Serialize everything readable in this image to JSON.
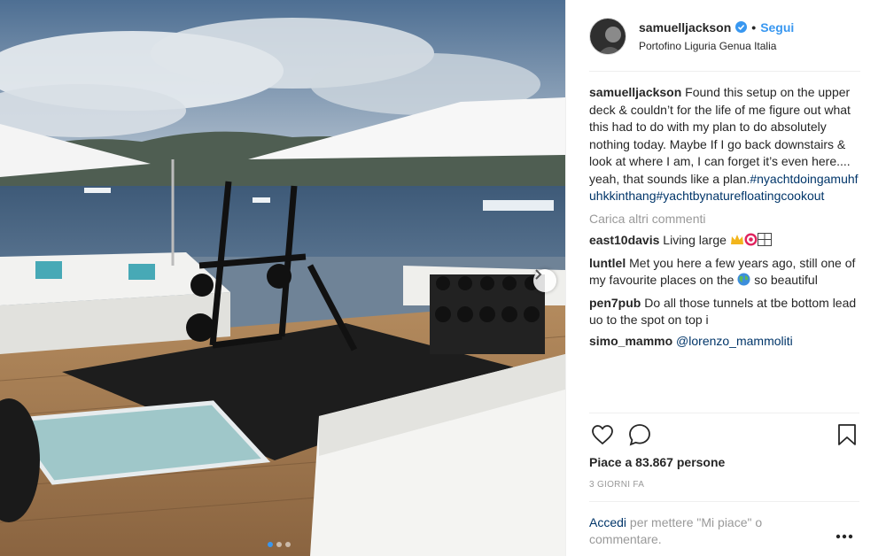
{
  "post": {
    "username": "samuelljackson",
    "separator": "•",
    "follow_label": "Segui",
    "location": "Portofino Liguria Genua Italia",
    "caption": {
      "text": "Found this setup on the upper deck & couldn’t for the life of me figure out what this had to do with my plan to do absolutely nothing today. Maybe If I go back downstairs & look at where I am, I can forget it’s even here.... yeah, that sounds like a plan.",
      "hashtags": "#nyachtdoingamuhfuhkkinthang#yachtbynaturefloatingcookout"
    },
    "load_more_label": "Carica altri commenti",
    "comments": [
      {
        "user": "east10davis",
        "text": "Living large"
      },
      {
        "user": "luntlel",
        "text": "Met you here a few years ago, still one of my favourite places on the",
        "text_after_emoji": "so beautiful"
      },
      {
        "user": "pen7pub",
        "text": "Do all those tunnels at tbe bottom lead uo to the spot on top i"
      },
      {
        "user": "simo_mammo",
        "mention": "@lorenzo_mammoliti"
      }
    ],
    "likes_label": "Piace a 83.867 persone",
    "timestamp": "3 GIORNI FA",
    "login_link": "Accedi",
    "login_text": "per mettere \"Mi piace\" o commentare.",
    "icons": {
      "like": "heart-icon",
      "comment": "comment-icon",
      "save": "bookmark-icon",
      "more": "more-options-icon",
      "verified": "verified-badge-icon",
      "next": "chevron-right-icon"
    },
    "carousel": {
      "slides": 3,
      "active_index": 0
    }
  },
  "colors": {
    "link": "#3897f0",
    "hashtag": "#003569",
    "muted": "#999999",
    "text": "#262626"
  }
}
